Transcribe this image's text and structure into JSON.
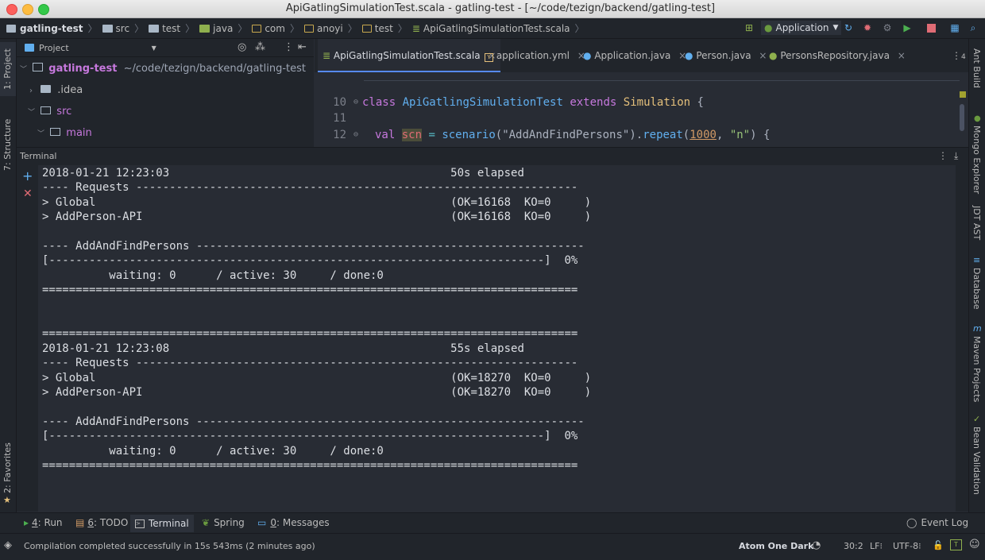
{
  "window": {
    "title": "ApiGatlingSimulationTest.scala - gatling-test - [~/code/tezign/backend/gatling-test]"
  },
  "breadcrumbs": [
    "gatling-test",
    "src",
    "test",
    "java",
    "com",
    "anoyi",
    "test",
    "ApiGatlingSimulationTest.scala"
  ],
  "run_config": "Application",
  "left_stripe": {
    "project": "1: Project",
    "structure": "7: Structure",
    "favorites": "2: Favorites"
  },
  "right_stripe": [
    "Ant Build",
    "Mongo Explorer",
    "JDT AST",
    "Database",
    "Maven Projects",
    "Bean Validation"
  ],
  "project_panel": {
    "selector": "Project",
    "root_name": "gatling-test",
    "root_path": "~/code/tezign/backend/gatling-test",
    "items": [
      ".idea",
      "src",
      "main"
    ]
  },
  "tabs": [
    {
      "label": "ApiGatlingSimulationTest.scala",
      "active": true
    },
    {
      "label": "application.yml",
      "active": false
    },
    {
      "label": "Application.java",
      "active": false
    },
    {
      "label": "Person.java",
      "active": false
    },
    {
      "label": "PersonsRepository.java",
      "active": false
    }
  ],
  "tabs_overflow": "4",
  "editor": {
    "line_numbers": [
      "10",
      "11",
      "12"
    ],
    "line10": {
      "kw1": "class",
      "name": "ApiGatlingSimulationTest",
      "kw2": "extends",
      "type": "Simulation",
      "brace": " {"
    },
    "line12": {
      "kw": "val",
      "var": "scn",
      "eq": " = ",
      "fn": "scenario",
      "str1": "(\"AddAndFindPersons\")",
      "dot": ".",
      "fn2": "repeat",
      "open": "(",
      "num": "1000",
      "comma": ", ",
      "str2": "\"n\"",
      "close": ") {"
    }
  },
  "terminal": {
    "title": "Terminal",
    "lines": [
      "2018-01-21 12:23:03                                          50s elapsed",
      "---- Requests ------------------------------------------------------------------",
      "> Global                                                     (OK=16168  KO=0     )",
      "> AddPerson-API                                              (OK=16168  KO=0     )",
      "",
      "---- AddAndFindPersons ----------------------------------------------------------",
      "[--------------------------------------------------------------------------]  0%",
      "          waiting: 0      / active: 30     / done:0",
      "================================================================================",
      "",
      "",
      "================================================================================",
      "2018-01-21 12:23:08                                          55s elapsed",
      "---- Requests ------------------------------------------------------------------",
      "> Global                                                     (OK=18270  KO=0     )",
      "> AddPerson-API                                              (OK=18270  KO=0     )",
      "",
      "---- AddAndFindPersons ----------------------------------------------------------",
      "[--------------------------------------------------------------------------]  0%",
      "          waiting: 0      / active: 30     / done:0",
      "================================================================================"
    ]
  },
  "bottom_tools": {
    "run_num": "4",
    "run": ": Run",
    "todo_num": "6",
    "todo": ": TODO",
    "terminal": "Terminal",
    "spring": "Spring",
    "messages_num": "0",
    "messages": ": Messages",
    "event_log": "Event Log"
  },
  "status": {
    "message": "Compilation completed successfully in 15s 543ms (2 minutes ago)",
    "theme": "Atom One Dark",
    "position": "30:2",
    "line_sep": "LF",
    "encoding": "UTF-8"
  },
  "colors": {
    "accent": "#568af2",
    "keyword": "#c678dd",
    "string": "#98c379",
    "function": "#61afef",
    "type": "#e5c07b",
    "number": "#d19a66",
    "operator": "#56b6c2"
  }
}
